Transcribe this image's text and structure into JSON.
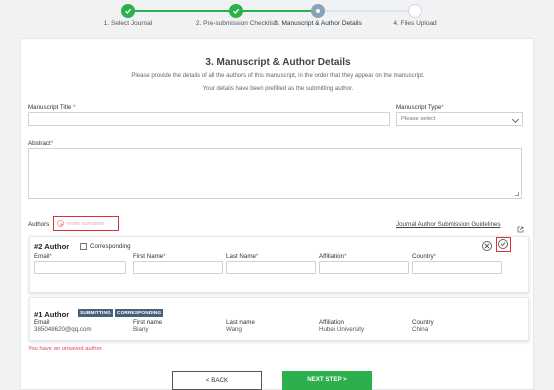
{
  "stepper": {
    "steps": [
      {
        "label": "1. Select Journal",
        "state": "done"
      },
      {
        "label": "2. Pre-submission Checklist",
        "state": "done"
      },
      {
        "label": "3. Manuscript & Author Details",
        "state": "current"
      },
      {
        "label": "4. Files Upload",
        "state": "todo"
      }
    ]
  },
  "form": {
    "title": "3. Manuscript & Author Details",
    "intro1": "Please provide the details of all the authors of this manuscript, in the order that they appear on the manuscript.",
    "intro2": "Your details have been prefilled as the submitting author.",
    "manuscript_title_label": "Manuscript Title",
    "manuscript_type_label": "Manuscript Type",
    "manuscript_type_value": "Please select",
    "abstract_label": "Abstract",
    "authors_label": "Authors",
    "add_author_placeholder": "enter surname",
    "guidelines_link": "Journal Author Submission Guidelines",
    "required_mark": "*"
  },
  "author2": {
    "heading": "#2 Author",
    "corresponding_label": "Corresponding",
    "email_label": "Email",
    "first_name_label": "First Name",
    "last_name_label": "Last Name",
    "affiliation_label": "Affiliation",
    "country_label": "Country"
  },
  "author1": {
    "heading": "#1 Author",
    "badge_submitting": "SUBMITTING",
    "badge_corresponding": "CORRESPONDING",
    "email_label": "Email",
    "email": "385048620@qq.com",
    "first_name_label": "First name",
    "first_name": "Biany",
    "last_name_label": "Last name",
    "last_name": "Wang",
    "affiliation_label": "Affiliation",
    "affiliation": "Hubei University",
    "country_label": "Country",
    "country": "China"
  },
  "warning": "You have an unsaved author.",
  "buttons": {
    "back": "< BACK",
    "next": "NEXT STEP >"
  },
  "colors": {
    "accent_green": "#2cb04e",
    "required_red": "#e0445a",
    "highlight_red": "#d9303c",
    "badge": "#48607a"
  }
}
